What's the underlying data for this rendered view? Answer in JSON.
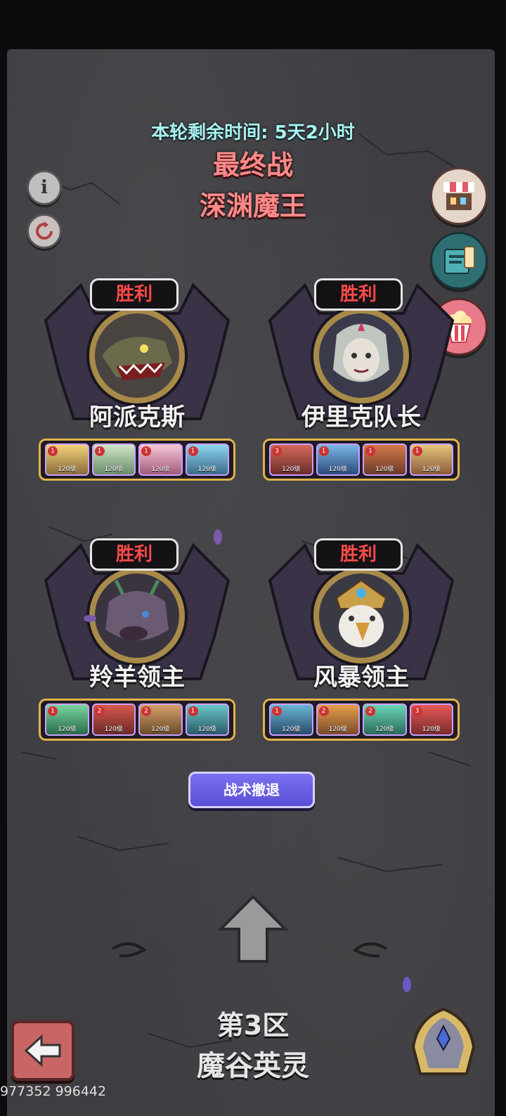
{
  "header": {
    "timer_text": "本轮剩余时间: 5天2小时",
    "stage_label": "最终战",
    "boss_title": "深渊魔王"
  },
  "left_buttons": {
    "info_icon": "info-icon",
    "refresh_icon": "refresh-icon"
  },
  "right_buttons": [
    {
      "name": "shop",
      "icon": "shop-stall-icon"
    },
    {
      "name": "book",
      "icon": "book-scroll-icon"
    },
    {
      "name": "rewards",
      "icon": "popcorn-icon"
    }
  ],
  "bosses": [
    {
      "status": "胜利",
      "name": "阿派克斯",
      "heroes": [
        {
          "rank": "1",
          "level": "120级"
        },
        {
          "rank": "1",
          "level": "120级"
        },
        {
          "rank": "1",
          "level": "120级"
        },
        {
          "rank": "1",
          "level": "120级"
        }
      ]
    },
    {
      "status": "胜利",
      "name": "伊里克队长",
      "heroes": [
        {
          "rank": "3",
          "level": "120级"
        },
        {
          "rank": "1",
          "level": "120级"
        },
        {
          "rank": "1",
          "level": "120级"
        },
        {
          "rank": "1",
          "level": "120级"
        }
      ]
    },
    {
      "status": "胜利",
      "name": "羚羊领主",
      "heroes": [
        {
          "rank": "1",
          "level": "120级"
        },
        {
          "rank": "2",
          "level": "120级"
        },
        {
          "rank": "2",
          "level": "120级"
        },
        {
          "rank": "1",
          "level": "120级"
        }
      ]
    },
    {
      "status": "胜利",
      "name": "风暴领主",
      "heroes": [
        {
          "rank": "1",
          "level": "120级"
        },
        {
          "rank": "2",
          "level": "120级"
        },
        {
          "rank": "2",
          "level": "120级"
        },
        {
          "rank": "3",
          "level": "120级"
        }
      ]
    }
  ],
  "retreat_button": "战术撤退",
  "zone": {
    "number": "第3区",
    "name": "魔谷英灵"
  },
  "footer_id": "977352 996442",
  "colors": {
    "timer": "#a8f3f2",
    "title": "#ff8a8a",
    "victory": "#ff4a4a",
    "retreat": "#6a5fe6",
    "stone": "#3e3d41"
  }
}
